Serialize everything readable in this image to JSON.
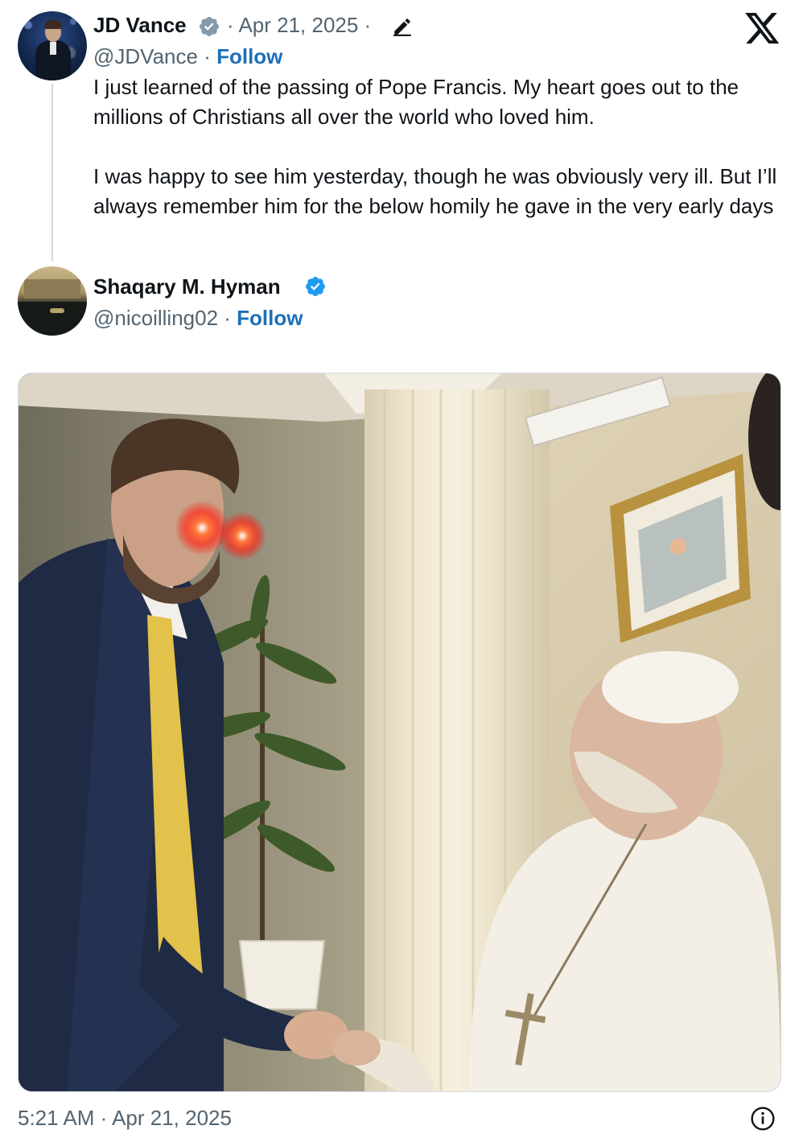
{
  "post": {
    "author": {
      "name": "JD Vance",
      "handle": "@JDVance",
      "separator": " · ",
      "follow_label": "Follow",
      "avatar_icon": "profile-photo"
    },
    "date_meta": "· Apr 21, 2025 ·",
    "edited_icon": "pencil-icon",
    "paragraphs": [
      "I just learned of the passing of Pope Francis. My heart goes out to the millions of Christians all over the world who loved him.",
      "I was happy to see him yesterday, though he was obviously very ill. But I’ll always remember him for the below homily he gave in the very early days"
    ],
    "timestamp": "5:21 AM · Apr 21, 2025",
    "platform_icon": "x-logo-icon"
  },
  "quoted": {
    "name": "Shaqary M. Hyman",
    "handle": "@nicoilling02",
    "separator": " · ",
    "follow_label": "Follow"
  },
  "colors": {
    "text": "#0f1419",
    "secondary": "#536471",
    "follow": "#1d70b8",
    "verified": "#1d9bf0",
    "verified_gray": "#829aab"
  }
}
